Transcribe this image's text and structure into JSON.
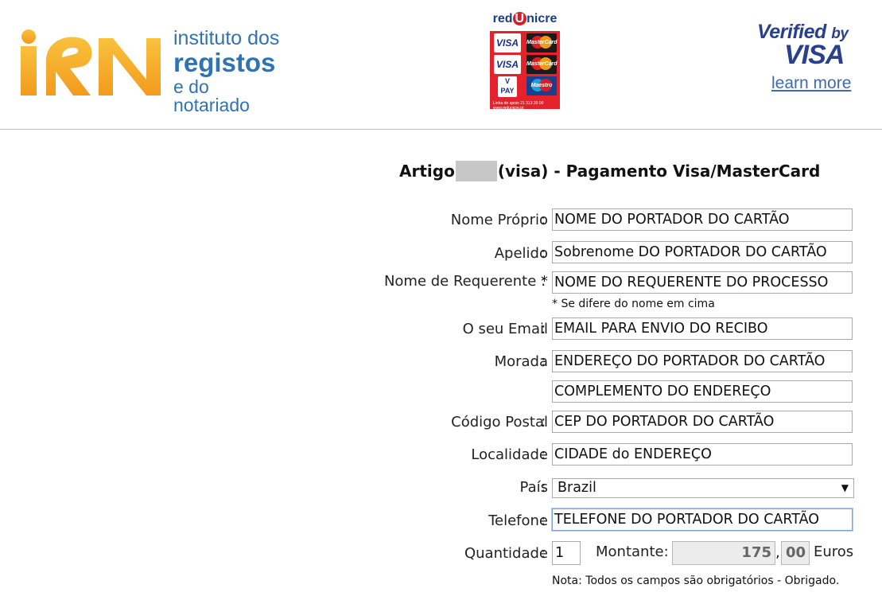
{
  "header": {
    "irn": {
      "line1": "instituto dos",
      "line2": "registos",
      "line3": "e do notariado"
    },
    "redunicre": {
      "title_red": "red",
      "title_u": "U",
      "title_rest": "nicre",
      "cards": [
        "VISA",
        "MasterCard",
        "VISA",
        "MasterCard",
        "V PAY",
        "Maestro"
      ],
      "footer": "Linha de apoio 21 313 20 00   www.redunicre.pt"
    },
    "visa_badge": {
      "verified": "Verified",
      "by": "by",
      "visa": "VISA",
      "learn_more": "learn more"
    }
  },
  "form": {
    "title_start": "Artigo",
    "title_end": "(visa) - Pagamento Visa/MasterCard",
    "fields": {
      "nome_proprio": {
        "label": "Nome Próprio",
        "value": "NOME DO PORTADOR DO CARTÃO"
      },
      "apelido": {
        "label": "Apelido",
        "value": "Sobrenome DO PORTADOR DO CARTÃO"
      },
      "requerente": {
        "label": "Nome de Requerente *",
        "value": "NOME DO REQUERENTE DO PROCESSO",
        "hint": "* Se difere do nome em cima"
      },
      "email": {
        "label": "O seu Email",
        "value": "EMAIL PARA ENVIO DO RECIBO"
      },
      "morada": {
        "label": "Morada",
        "value": "ENDEREÇO DO PORTADOR DO CARTÃO",
        "value2": "COMPLEMENTO DO ENDEREÇO"
      },
      "codigo_postal": {
        "label": "Código Postal",
        "value": "CEP DO PORTADOR DO CARTÃO"
      },
      "localidade": {
        "label": "Localidade",
        "value": "CIDADE do ENDEREÇO"
      },
      "pais": {
        "label": "País",
        "value": "Brazil"
      },
      "telefone": {
        "label": "Telefone",
        "value": "TELEFONE DO PORTADOR DO CARTÃO"
      },
      "quantidade": {
        "label": "Quantidade",
        "value": "1"
      }
    },
    "montante": {
      "label": "Montante:",
      "integer": "175",
      "decimal": "00",
      "currency": "Euros"
    },
    "colon": ":",
    "comma": ",",
    "nota": "Nota: Todos os campos são obrigatórios - Obrigado."
  },
  "colors": {
    "irn_orange": "#f5a623",
    "irn_blue": "#2f73b3",
    "visa_blue": "#29408f",
    "redunicre_red": "#e5222b"
  }
}
